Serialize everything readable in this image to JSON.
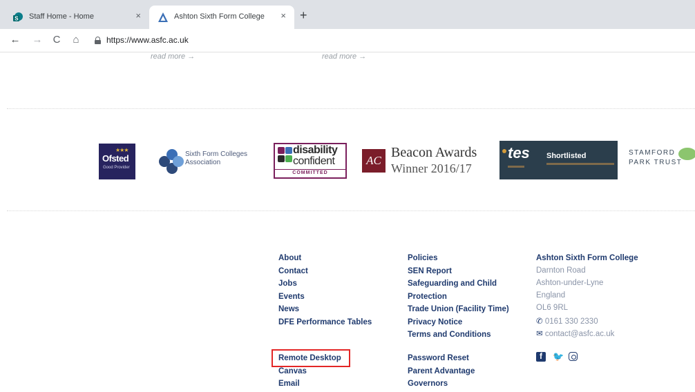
{
  "browser": {
    "tabs": [
      {
        "title": "Staff Home - Home",
        "close": "×"
      },
      {
        "title": "Ashton Sixth Form College",
        "close": "×"
      }
    ],
    "new_tab": "+",
    "nav": {
      "back": "←",
      "forward": "→",
      "reload": "C",
      "home": "⌂"
    },
    "url": "https://www.asfc.ac.uk"
  },
  "read_more": [
    "read more →",
    "read more →"
  ],
  "logos": {
    "ofsted": {
      "name": "Ofsted",
      "stars": "★★★",
      "rating": "Good Provider"
    },
    "sfca": {
      "line1": "Sixth Form Colleges",
      "line2": "Association"
    },
    "disability": {
      "word1": "disability",
      "word2": "confident",
      "badge": "COMMITTED"
    },
    "beacon": {
      "mark": "AC",
      "line1": "Beacon Awards",
      "line2": "Winner 2016/17"
    },
    "tes": {
      "brand": "tes",
      "label": "Shortlisted"
    },
    "stamford": {
      "line1": "STAMFORD",
      "line2": "PARK TRUST"
    }
  },
  "footer": {
    "col1": [
      "About",
      "Contact",
      "Jobs",
      "Events",
      "News",
      "DFE Performance Tables"
    ],
    "col1b": [
      "Remote Desktop",
      "Canvas",
      "Email"
    ],
    "col2": [
      "Policies",
      "SEN Report",
      "Safeguarding and Child",
      "Protection",
      "Trade Union (Facility Time)",
      "Privacy Notice",
      "Terms and Conditions"
    ],
    "col2b": [
      "Password Reset",
      "Parent Advantage",
      "Governors"
    ],
    "address": {
      "name": "Ashton Sixth Form College",
      "lines": [
        "Darnton Road",
        "Ashton-under-Lyne",
        "England",
        "OL6 9RL"
      ],
      "phone": "0161 330 2330",
      "email": "contact@asfc.ac.uk"
    }
  },
  "colors": {
    "link": "#1f3a6e",
    "highlight": "#e32626",
    "tes_bg": "#2b3e4c",
    "ofsted_bg": "#27235e"
  }
}
